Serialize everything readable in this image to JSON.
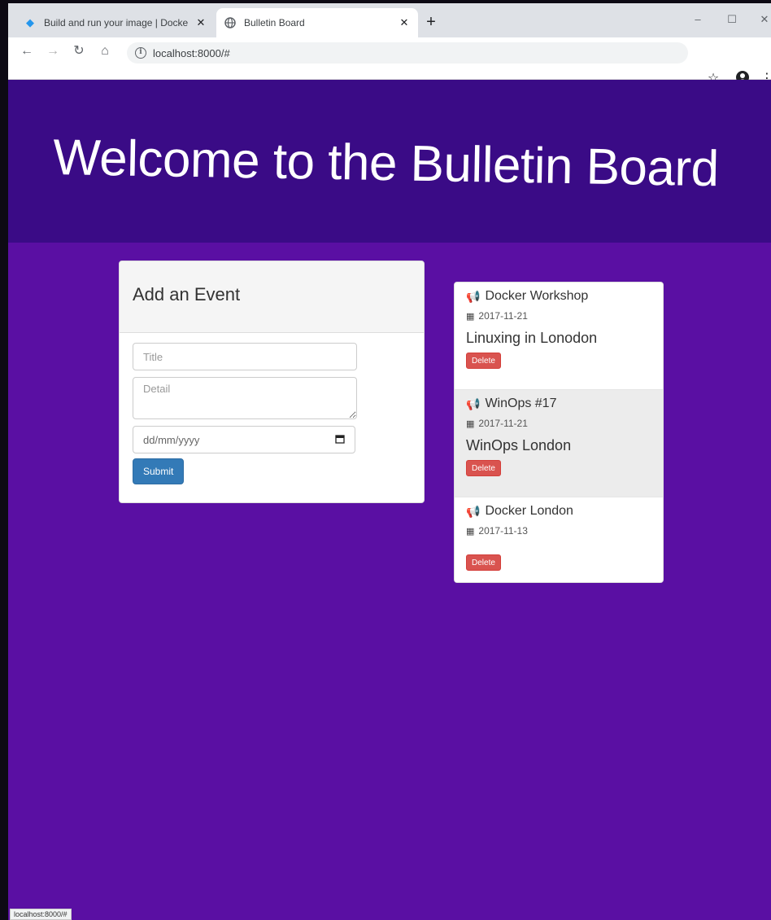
{
  "browser": {
    "tabs": [
      {
        "title": "Build and run your image | Docke",
        "favicon": "docker-icon",
        "active": false
      },
      {
        "title": "Bulletin Board",
        "favicon": "globe-icon",
        "active": true
      }
    ],
    "new_tab_symbol": "+",
    "close_symbol": "✕",
    "window_controls": {
      "minimize": "–",
      "maximize": "☐",
      "close": "✕"
    },
    "url": "localhost:8000/#",
    "status_url": "localhost:8000/#"
  },
  "page": {
    "title": "Welcome to the Bulletin Board",
    "colors": {
      "header_bg": "#3a0b86",
      "page_bg": "#5a0fa3",
      "submit": "#337ab7",
      "delete": "#d9534f"
    }
  },
  "add_event": {
    "heading": "Add an Event",
    "title_placeholder": "Title",
    "detail_placeholder": "Detail",
    "date_placeholder": "dd/mm/yyyy",
    "submit_label": "Submit"
  },
  "events": [
    {
      "title": "Docker Workshop",
      "date": "2017-11-21",
      "detail": "Linuxing in Lonodon",
      "delete_label": "Delete"
    },
    {
      "title": "WinOps #17",
      "date": "2017-11-21",
      "detail": "WinOps London",
      "delete_label": "Delete"
    },
    {
      "title": "Docker London",
      "date": "2017-11-13",
      "detail": "",
      "delete_label": "Delete"
    }
  ]
}
